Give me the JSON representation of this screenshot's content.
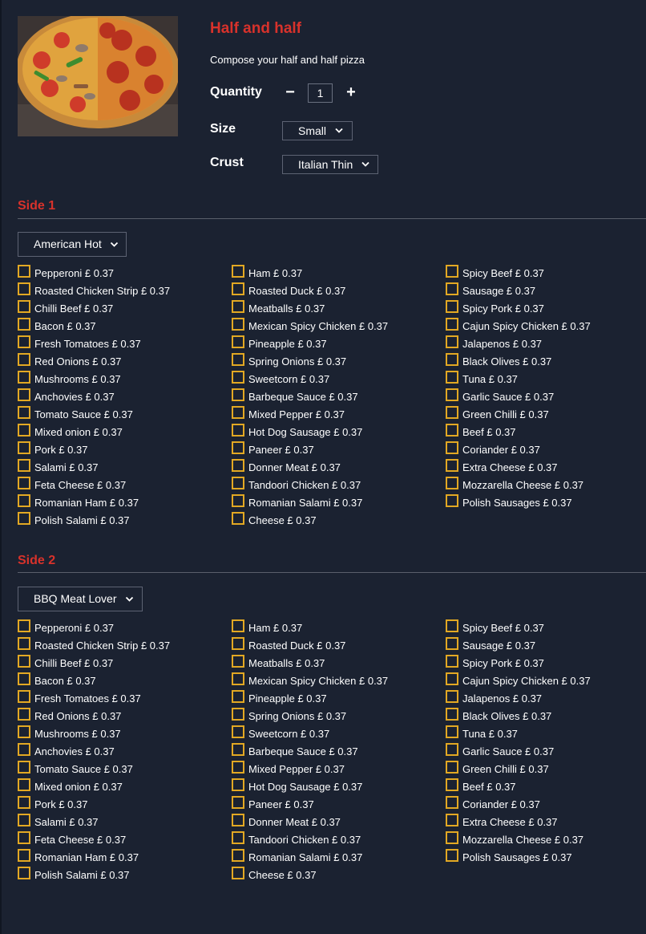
{
  "product": {
    "title": "Half and half",
    "subtitle": "Compose your half and half pizza"
  },
  "quantity": {
    "label": "Quantity",
    "value": "1",
    "minus": "−",
    "plus": "+"
  },
  "size": {
    "label": "Size",
    "selected": "Small"
  },
  "crust": {
    "label": "Crust",
    "selected": "Italian Thin"
  },
  "colors": {
    "background": "#1b2231",
    "accent": "#d8322b",
    "checkbox": "#e2a823"
  },
  "toppings": [
    "Pepperoni £ 0.37",
    "Roasted Chicken Strip £ 0.37",
    "Chilli Beef £ 0.37",
    "Bacon £ 0.37",
    "Fresh Tomatoes £ 0.37",
    "Red Onions £ 0.37",
    "Mushrooms £ 0.37",
    "Anchovies £ 0.37",
    "Tomato Sauce £ 0.37",
    "Mixed onion £ 0.37",
    "Pork £ 0.37",
    "Salami £ 0.37",
    "Feta Cheese £ 0.37",
    "Romanian Ham £ 0.37",
    "Polish Salami £ 0.37",
    "Ham £ 0.37",
    "Roasted Duck £ 0.37",
    "Meatballs £ 0.37",
    "Mexican Spicy Chicken £ 0.37",
    "Pineapple £ 0.37",
    "Spring Onions £ 0.37",
    "Sweetcorn £ 0.37",
    "Barbeque Sauce £ 0.37",
    "Mixed Pepper £ 0.37",
    "Hot Dog Sausage £ 0.37",
    "Paneer £ 0.37",
    "Donner Meat £ 0.37",
    "Tandoori Chicken £ 0.37",
    "Romanian Salami £ 0.37",
    "Cheese £ 0.37",
    "Spicy Beef £ 0.37",
    "Sausage £ 0.37",
    "Spicy Pork £ 0.37",
    "Cajun Spicy Chicken £ 0.37",
    "Jalapenos £ 0.37",
    "Black Olives £ 0.37",
    "Tuna £ 0.37",
    "Garlic Sauce £ 0.37",
    "Green Chilli £ 0.37",
    "Beef £ 0.37",
    "Coriander £ 0.37",
    "Extra Cheese £ 0.37",
    "Mozzarella Cheese £ 0.37",
    "Polish Sausages £ 0.37"
  ],
  "sides": [
    {
      "title": "Side 1",
      "selected_pizza": "American Hot"
    },
    {
      "title": "Side 2",
      "selected_pizza": "BBQ Meat Lover"
    }
  ]
}
